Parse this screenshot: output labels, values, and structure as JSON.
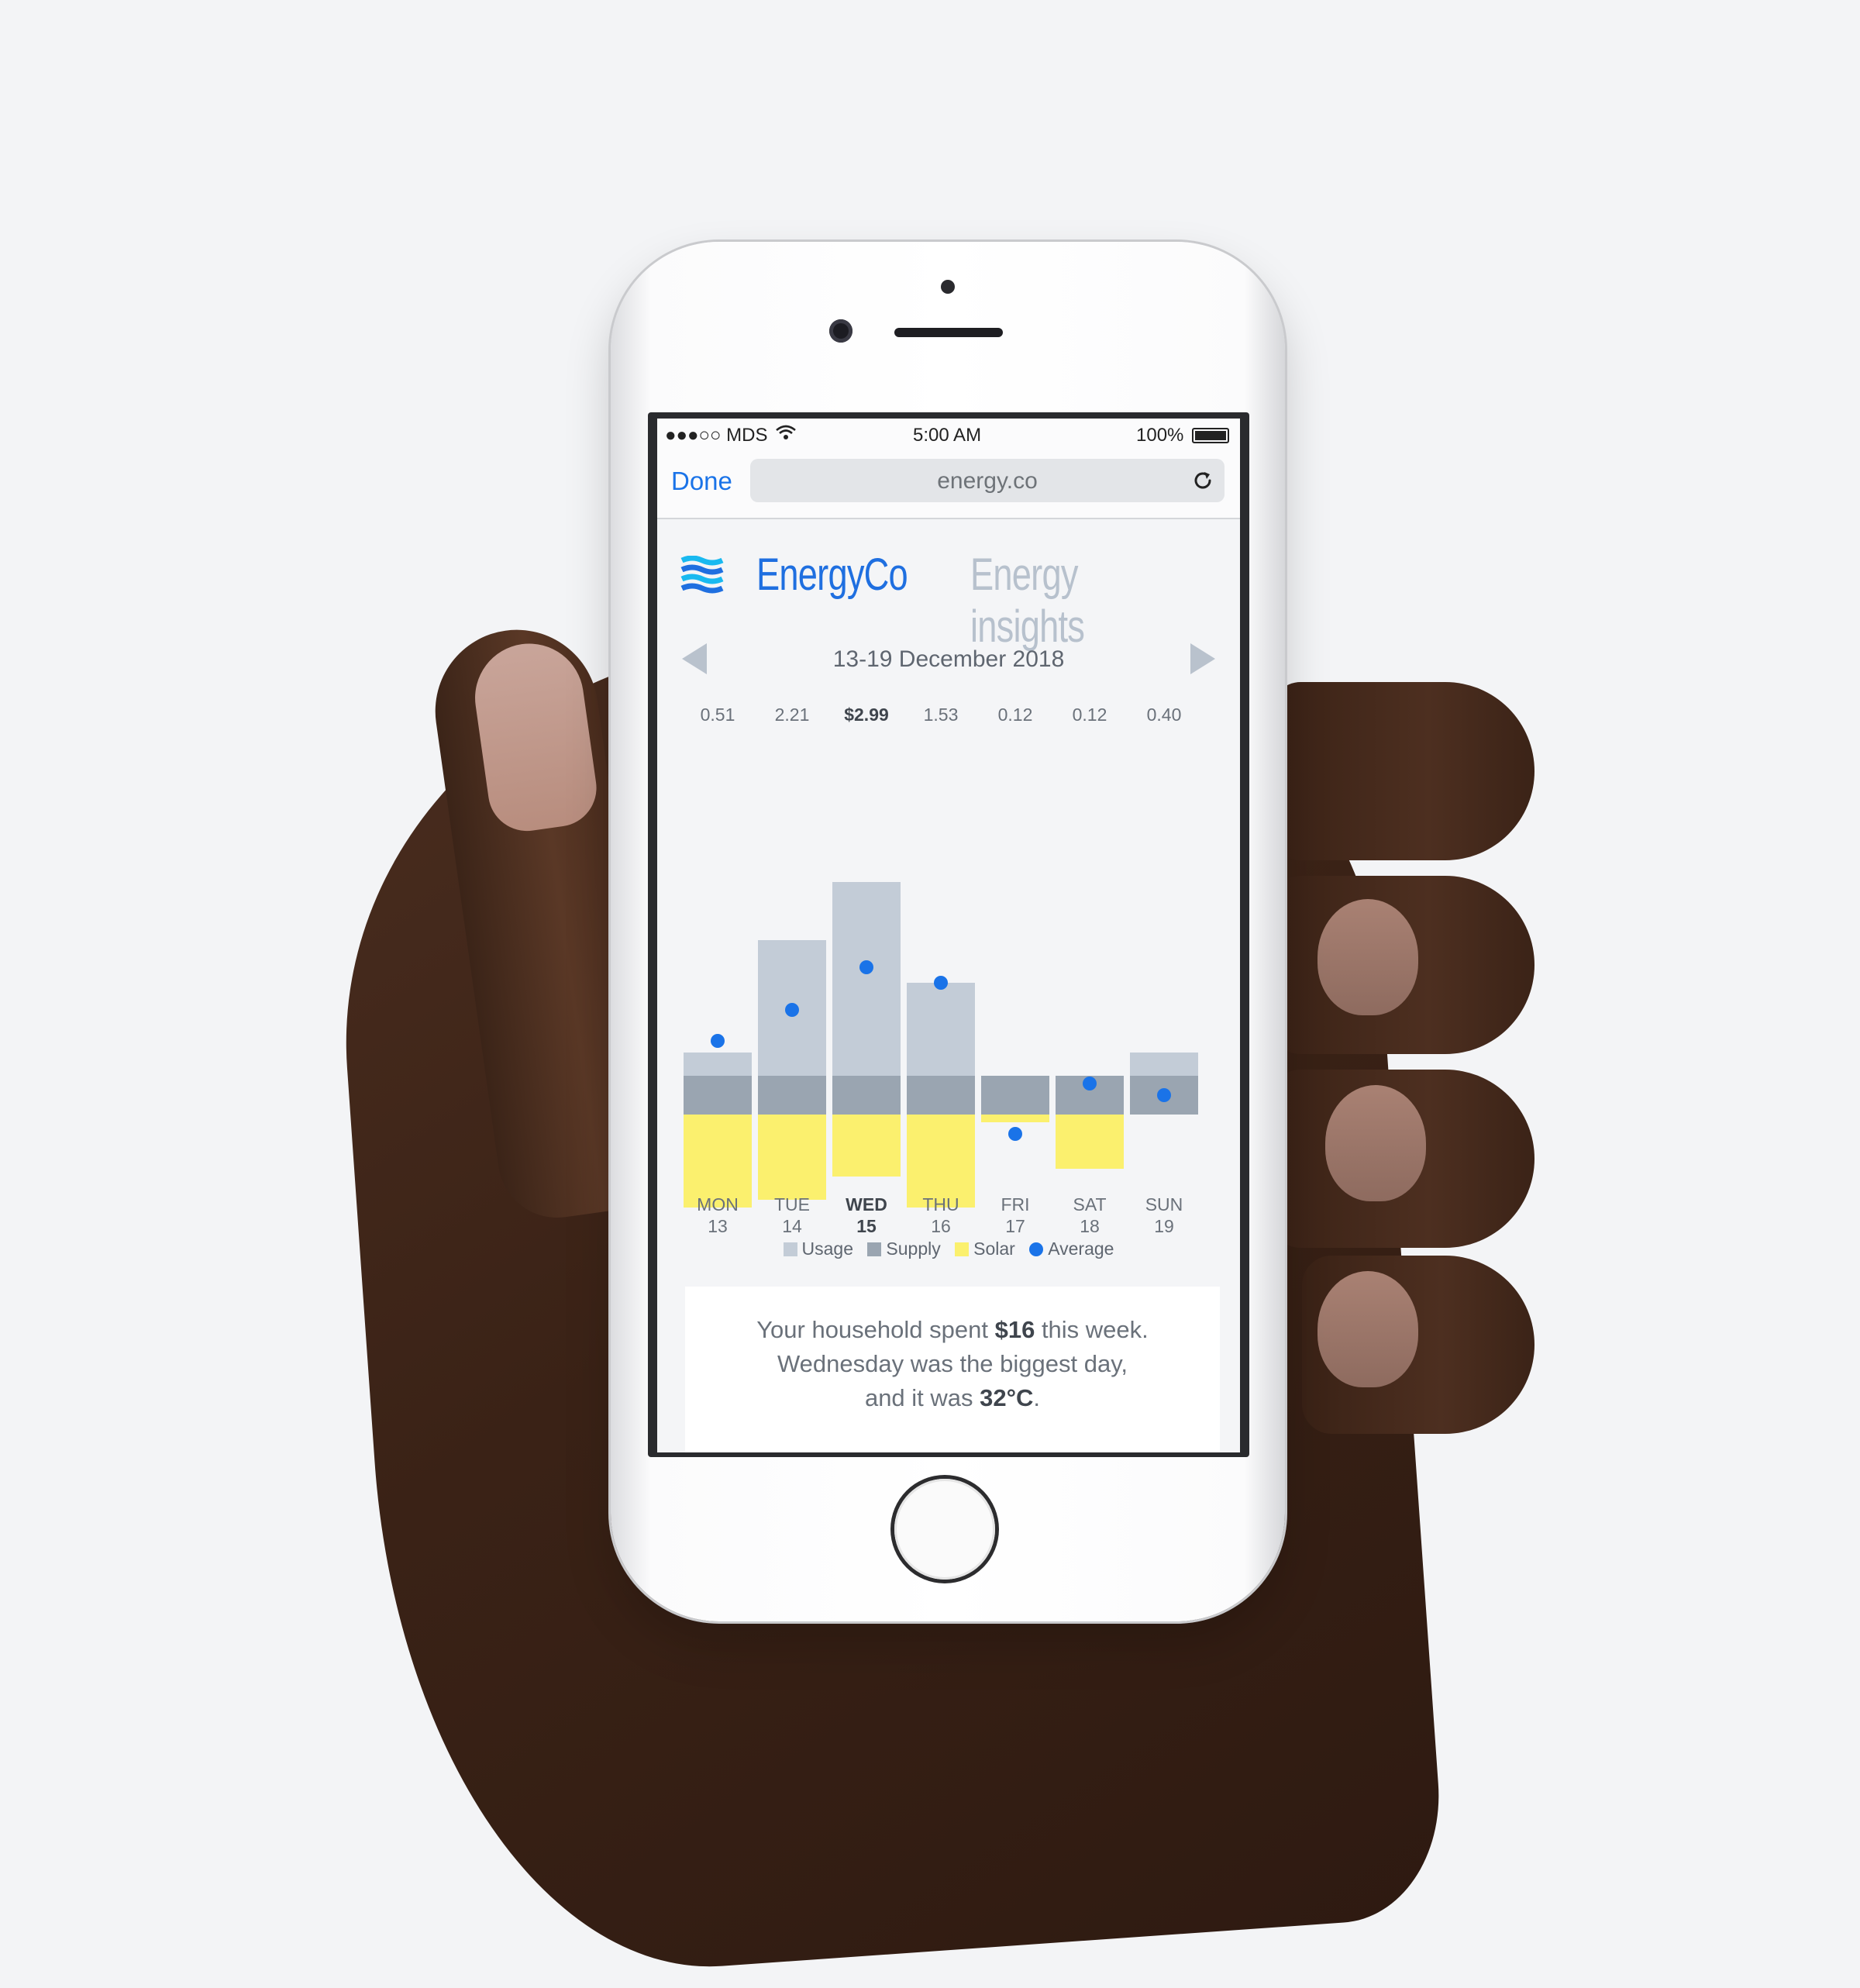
{
  "status_bar": {
    "carrier": "●●●○○ MDS",
    "time": "5:00 AM",
    "battery": "100%"
  },
  "browser": {
    "done_label": "Done",
    "url": "energy.co"
  },
  "header": {
    "brand": "EnergyCo",
    "section_title": "Energy insights"
  },
  "week": {
    "label": "13-19 December 2018"
  },
  "chart_data": {
    "type": "bar",
    "categories": [
      "MON 13",
      "TUE 14",
      "WED 15",
      "THU 16",
      "FRI 17",
      "SAT 18",
      "SUN 19"
    ],
    "day_names": [
      "MON",
      "TUE",
      "WED",
      "THU",
      "FRI",
      "SAT",
      "SUN"
    ],
    "day_numbers": [
      "13",
      "14",
      "15",
      "16",
      "17",
      "18",
      "19"
    ],
    "cost_labels": [
      "0.51",
      "2.21",
      "$2.99",
      "1.53",
      "0.12",
      "0.12",
      "0.40"
    ],
    "highlight_index": 2,
    "series": [
      {
        "name": "Usage",
        "values": [
          0.6,
          3.5,
          5.0,
          2.4,
          0.0,
          0.0,
          0.6
        ],
        "color": "#c3ccd7"
      },
      {
        "name": "Supply",
        "values": [
          1.0,
          1.0,
          1.0,
          1.0,
          1.0,
          1.0,
          1.0
        ],
        "color": "#9aa5b1"
      },
      {
        "name": "Solar",
        "values": [
          -2.4,
          -2.2,
          -1.6,
          -2.4,
          -0.2,
          -1.4,
          0.0
        ],
        "color": "#fbf06e"
      },
      {
        "name": "Average",
        "values": [
          1.4,
          2.2,
          3.3,
          2.9,
          -1.0,
          0.3,
          0.0
        ],
        "color": "#1a73e8"
      }
    ],
    "ylim": [
      -2.6,
      5.2
    ]
  },
  "summary": {
    "line1_pre": "Your household spent ",
    "line1_value": "$16",
    "line1_post": " this week.",
    "line2": "Wednesday was the biggest day,",
    "line3_pre": "and it was ",
    "line3_value": "32°C",
    "line3_post": "."
  },
  "colors": {
    "accent": "#1a73e8",
    "usage": "#c3ccd7",
    "supply": "#9aa5b1",
    "solar": "#fbf06e",
    "muted": "#b7c1cd"
  }
}
